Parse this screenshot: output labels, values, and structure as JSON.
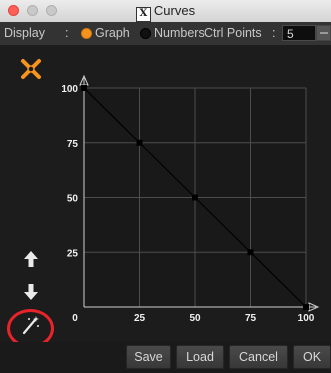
{
  "window": {
    "title": "Curves",
    "title_badge": "X"
  },
  "options": {
    "display_label": "Display",
    "separator": ":",
    "graph_label": "Graph",
    "numbers_label": "Numbers",
    "ctrl_points_label": "Ctrl Points",
    "ctrl_points_separator": ":",
    "ctrl_points_value": "5",
    "selected_display": "Graph"
  },
  "colors": {
    "accent": "#f7941d",
    "highlight": "#e8242a",
    "background": "#1c1c1c",
    "grid": "#4d4d4d"
  },
  "tools": [
    "reset-curve-icon",
    "arrow-up-icon",
    "arrow-down-icon",
    "magic-wand-icon"
  ],
  "chart_data": {
    "type": "line",
    "x": [
      0,
      25,
      50,
      75,
      100
    ],
    "y": [
      100,
      75,
      50,
      25,
      0
    ],
    "xticks": [
      "0",
      "25",
      "50",
      "75",
      "100"
    ],
    "yticks": [
      "100",
      "75",
      "50",
      "25",
      "0"
    ],
    "xlim": [
      0,
      100
    ],
    "ylim": [
      0,
      100
    ],
    "grid": true
  },
  "buttons": {
    "save": "Save",
    "load": "Load",
    "cancel": "Cancel",
    "ok": "OK"
  }
}
